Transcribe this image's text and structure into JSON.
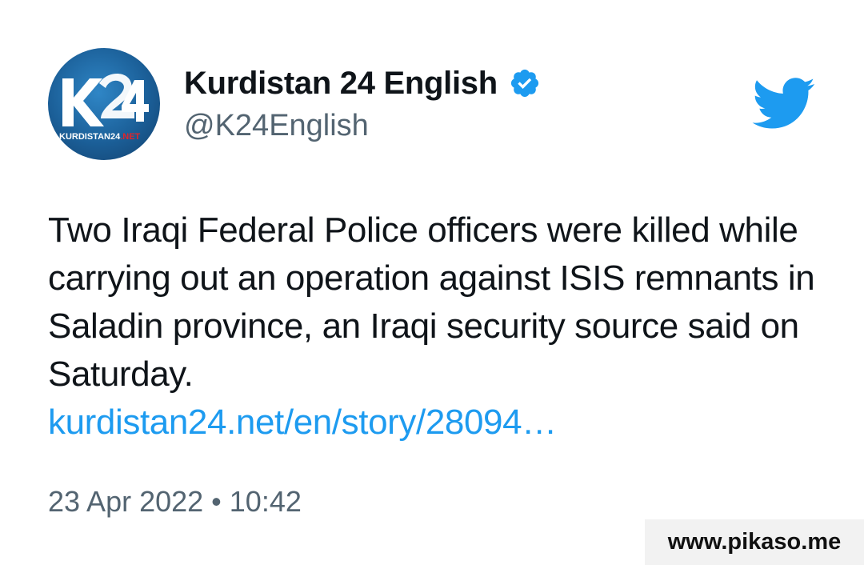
{
  "author": {
    "display_name": "Kurdistan 24 English",
    "handle": "@K24English",
    "verified": true,
    "avatar": {
      "logo_text": "K24",
      "logo_caption_white": "KURDISTAN24",
      "logo_caption_red": ".NET",
      "background_color": "#1b5f98"
    }
  },
  "platform_icon": "twitter-bird-icon",
  "tweet": {
    "text": "Two Iraqi Federal Police officers were killed while carrying out an operation against ISIS remnants in Saladin province, an Iraqi security source said on Saturday.",
    "link_text": "kurdistan24.net/en/story/28094…",
    "timestamp": "23 Apr 2022 • 10:42"
  },
  "watermark": "www.pikaso.me",
  "colors": {
    "text": "#0f1419",
    "secondary": "#536471",
    "link": "#1d9bf0",
    "verified": "#1d9bf0"
  }
}
